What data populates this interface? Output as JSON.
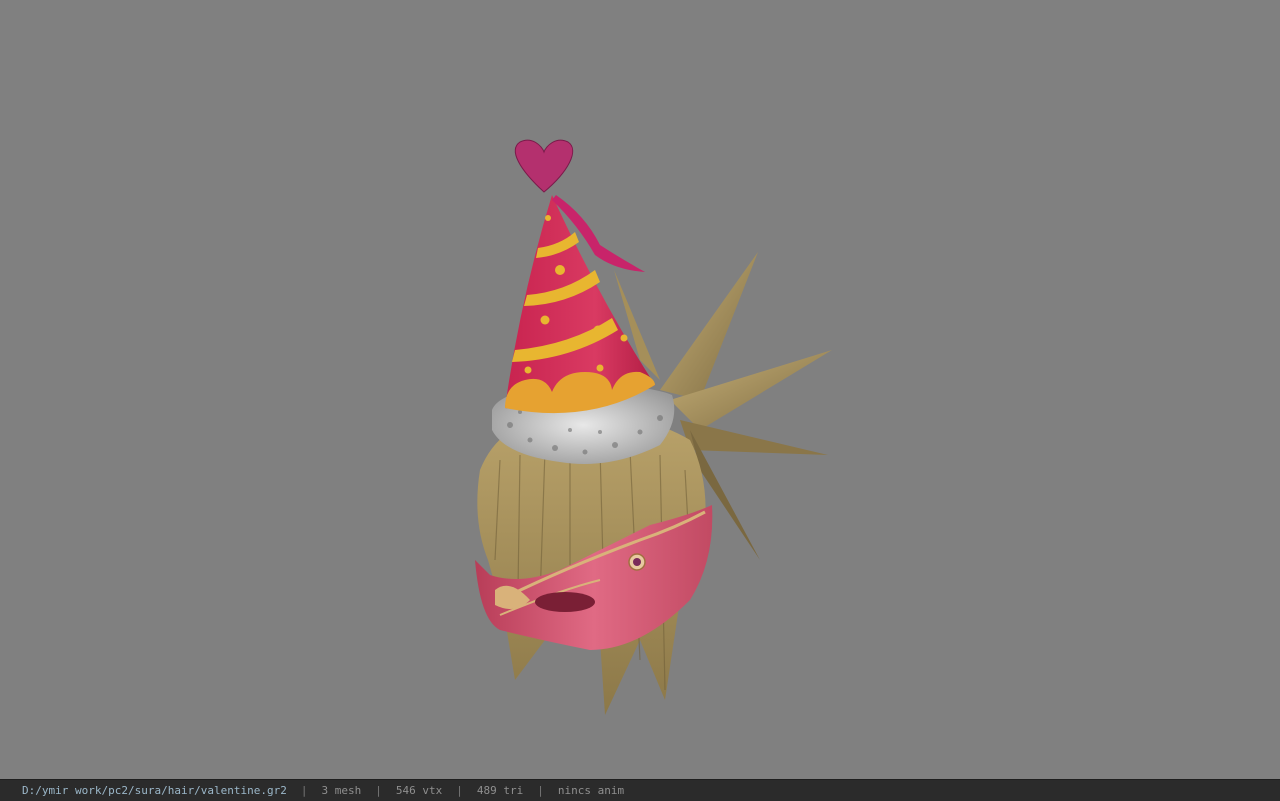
{
  "status_bar": {
    "file_path": "D:/ymir work/pc2/sura/hair/valentine.gr2",
    "separator": "|",
    "mesh_count": "3 mesh",
    "vertex_count": "546 vtx",
    "triangle_count": "489 tri",
    "animation": "nincs anim"
  },
  "viewport": {
    "background_color": "#808080",
    "model": "hair-with-party-hat-and-mask"
  }
}
